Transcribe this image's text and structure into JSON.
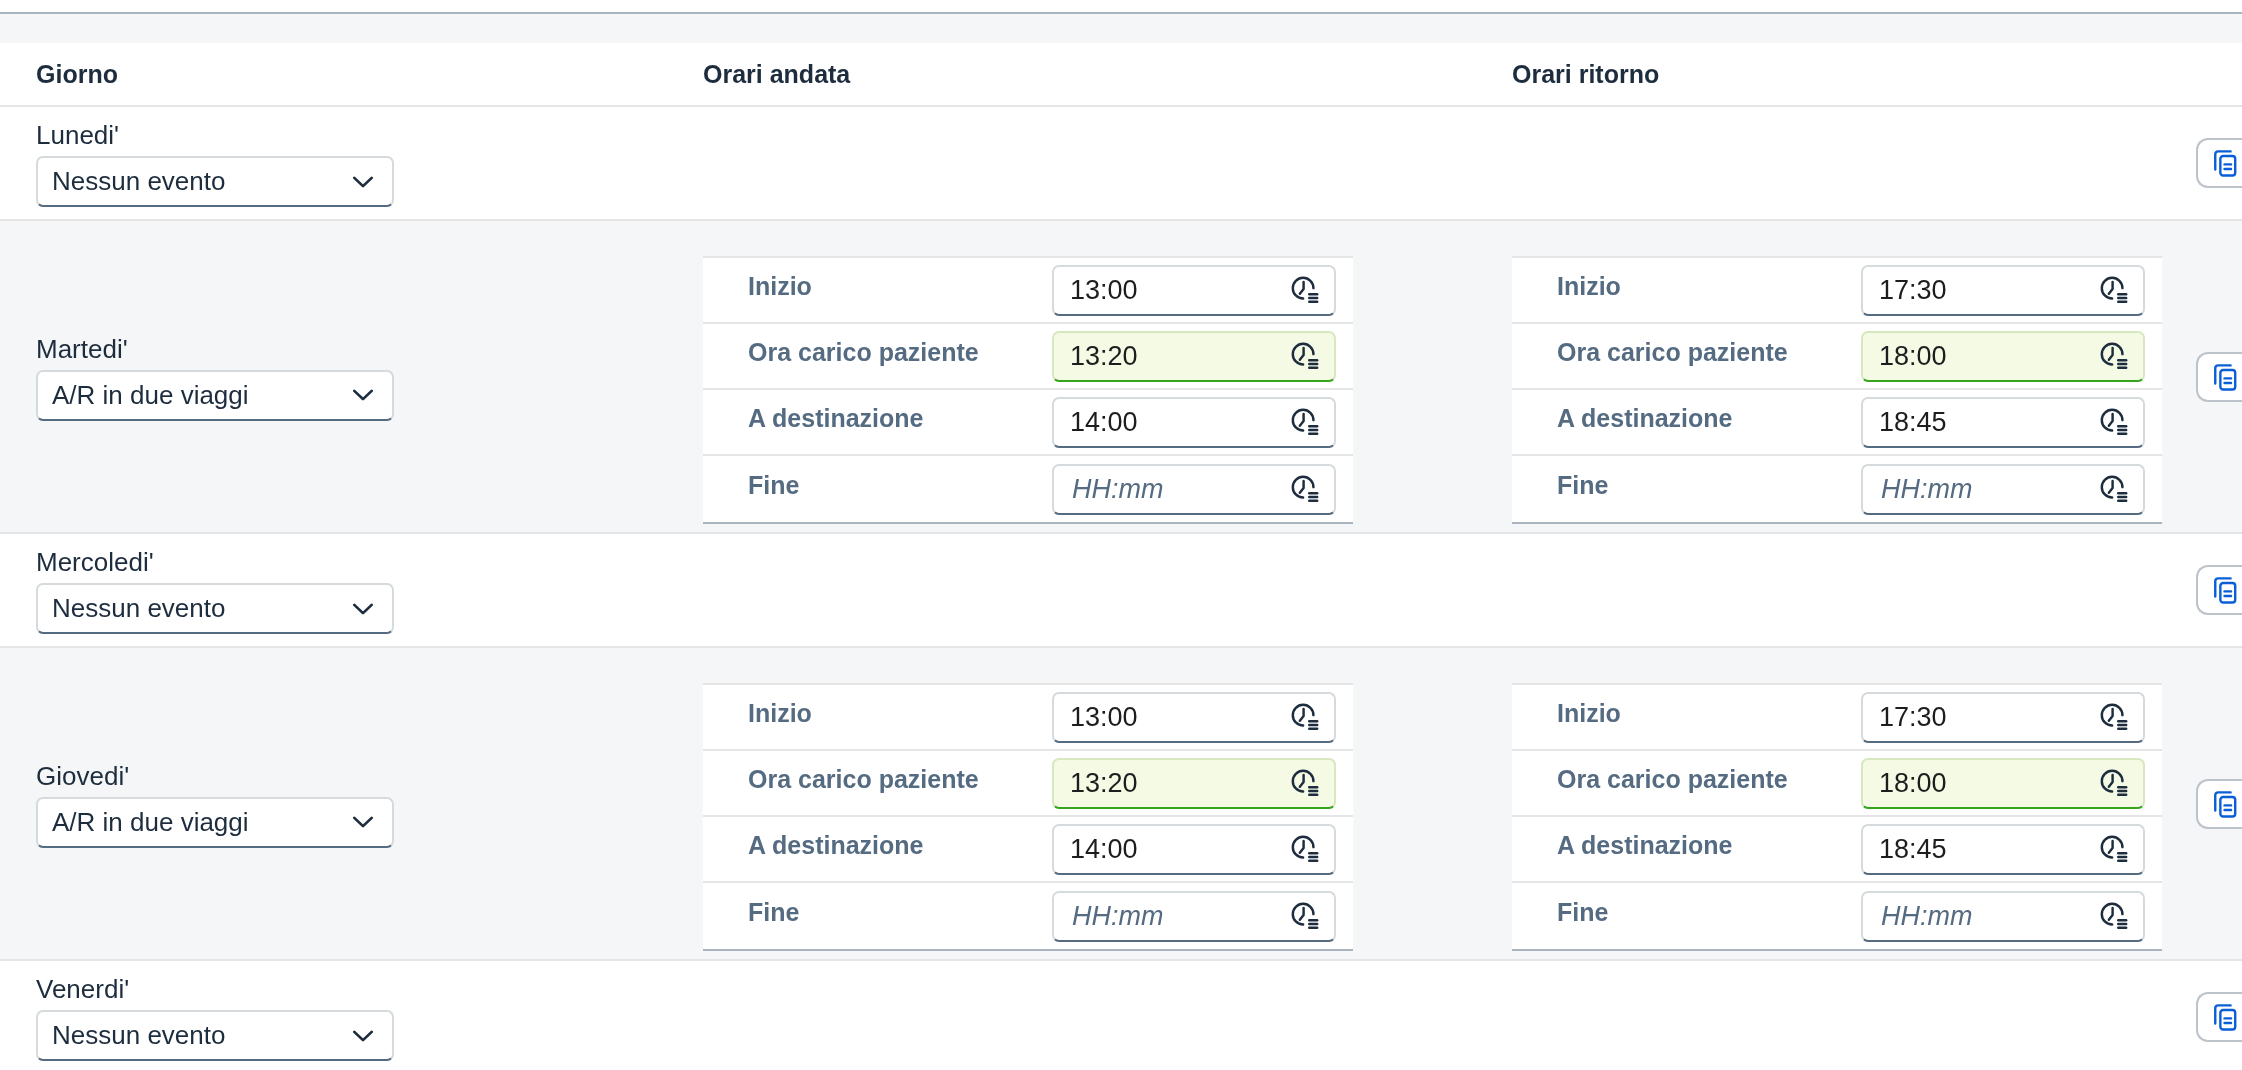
{
  "columns": [
    "Giorno",
    "Orari andata",
    "Orari ritorno"
  ],
  "days": [
    {
      "day": "Lunedi'",
      "event": "Nessun evento"
    },
    {
      "day": "Martedi'",
      "event": "A/R in due viaggi",
      "outbound_times": [
        {
          "label": "Inizio",
          "value": "13:00",
          "highlighted": false
        },
        {
          "label": "Ora carico paziente",
          "value": "13:20",
          "highlighted": true
        },
        {
          "label": "A destinazione",
          "value": "14:00",
          "highlighted": false
        },
        {
          "label": "Fine",
          "placeholder": "HH:mm",
          "highlighted": false
        }
      ],
      "return_times": [
        {
          "label": "Inizio",
          "value": "17:30",
          "highlighted": false
        },
        {
          "label": "Ora carico paziente",
          "value": "18:00",
          "highlighted": true
        },
        {
          "label": "A destinazione",
          "value": "18:45",
          "highlighted": false
        },
        {
          "label": "Fine",
          "placeholder": "HH:mm",
          "highlighted": false
        }
      ]
    },
    {
      "day": "Mercoledi'",
      "event": "Nessun evento"
    },
    {
      "day": "Giovedi'",
      "event": "A/R in due viaggi",
      "outbound_times": [
        {
          "label": "Inizio",
          "value": "13:00",
          "highlighted": false
        },
        {
          "label": "Ora carico paziente",
          "value": "13:20",
          "highlighted": true
        },
        {
          "label": "A destinazione",
          "value": "14:00",
          "highlighted": false
        },
        {
          "label": "Fine",
          "placeholder": "HH:mm",
          "highlighted": false
        }
      ],
      "return_times": [
        {
          "label": "Inizio",
          "value": "17:30",
          "highlighted": false
        },
        {
          "label": "Ora carico paziente",
          "value": "18:00",
          "highlighted": true
        },
        {
          "label": "A destinazione",
          "value": "18:45",
          "highlighted": false
        },
        {
          "label": "Fine",
          "placeholder": "HH:mm",
          "highlighted": false
        }
      ]
    },
    {
      "day": "Venerdi'",
      "event": "Nessun evento"
    }
  ]
}
